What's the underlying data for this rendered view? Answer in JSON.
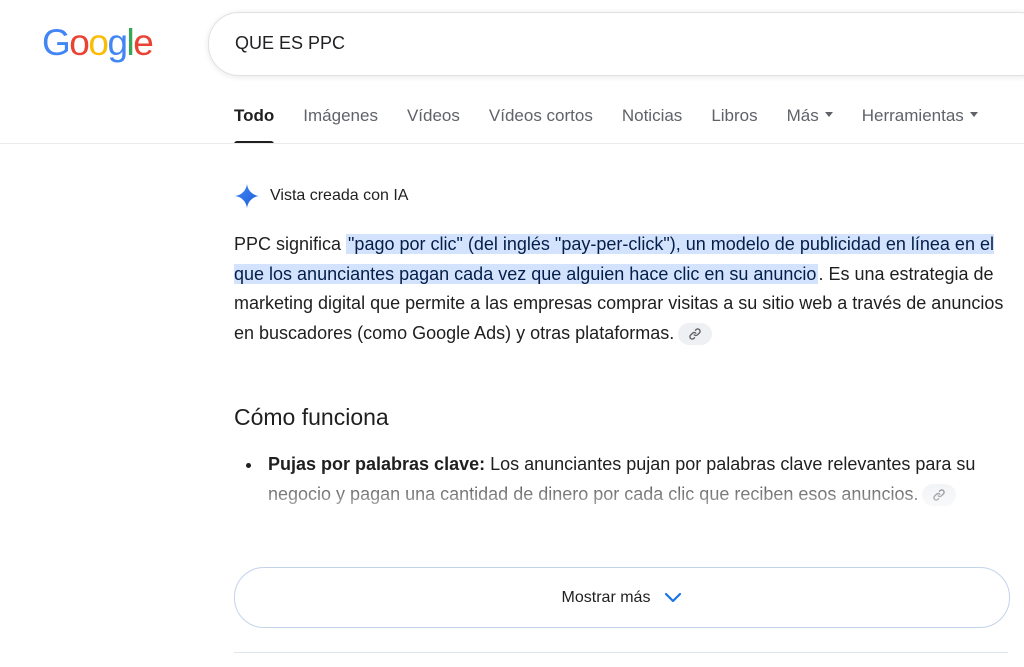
{
  "logo": {
    "text": "Google",
    "letters": [
      "G",
      "o",
      "o",
      "g",
      "l",
      "e"
    ],
    "colors": [
      "#4285F4",
      "#EA4335",
      "#FBBC05",
      "#4285F4",
      "#34A853",
      "#EA4335"
    ]
  },
  "search": {
    "query": "QUE ES PPC"
  },
  "tabs": [
    {
      "label": "Todo",
      "active": true
    },
    {
      "label": "Imágenes"
    },
    {
      "label": "Vídeos"
    },
    {
      "label": "Vídeos cortos"
    },
    {
      "label": "Noticias"
    },
    {
      "label": "Libros"
    },
    {
      "label": "Más",
      "dropdown": true
    },
    {
      "label": "Herramientas",
      "dropdown": true
    }
  ],
  "ai_overview": {
    "header_label": "Vista creada con IA",
    "intro_plain": "PPC significa ",
    "intro_highlight": "\"pago por clic\" (del inglés \"pay-per-click\"), un modelo de publicidad en línea en el que los anunciantes pagan cada vez que alguien hace clic en su anuncio",
    "intro_rest": ". Es una estrategia de marketing digital que permite a las empresas comprar visitas a su sitio web a través de anuncios en buscadores (como Google Ads) y otras plataformas.",
    "section_title": "Cómo funciona",
    "bullets": [
      {
        "bold": "Pujas por palabras clave:",
        "text": " Los anunciantes pujan por palabras clave relevantes para su negocio y pagan una cantidad de dinero por cada clic que reciben esos anuncios."
      }
    ],
    "show_more_label": "Mostrar más"
  },
  "icons": {
    "ai": "gemini-sparkle-icon",
    "citation": "link-icon",
    "expand": "chevron-down-icon"
  },
  "colors": {
    "accent_blue": "#1a73e8",
    "highlight": "#d3e3fd"
  }
}
